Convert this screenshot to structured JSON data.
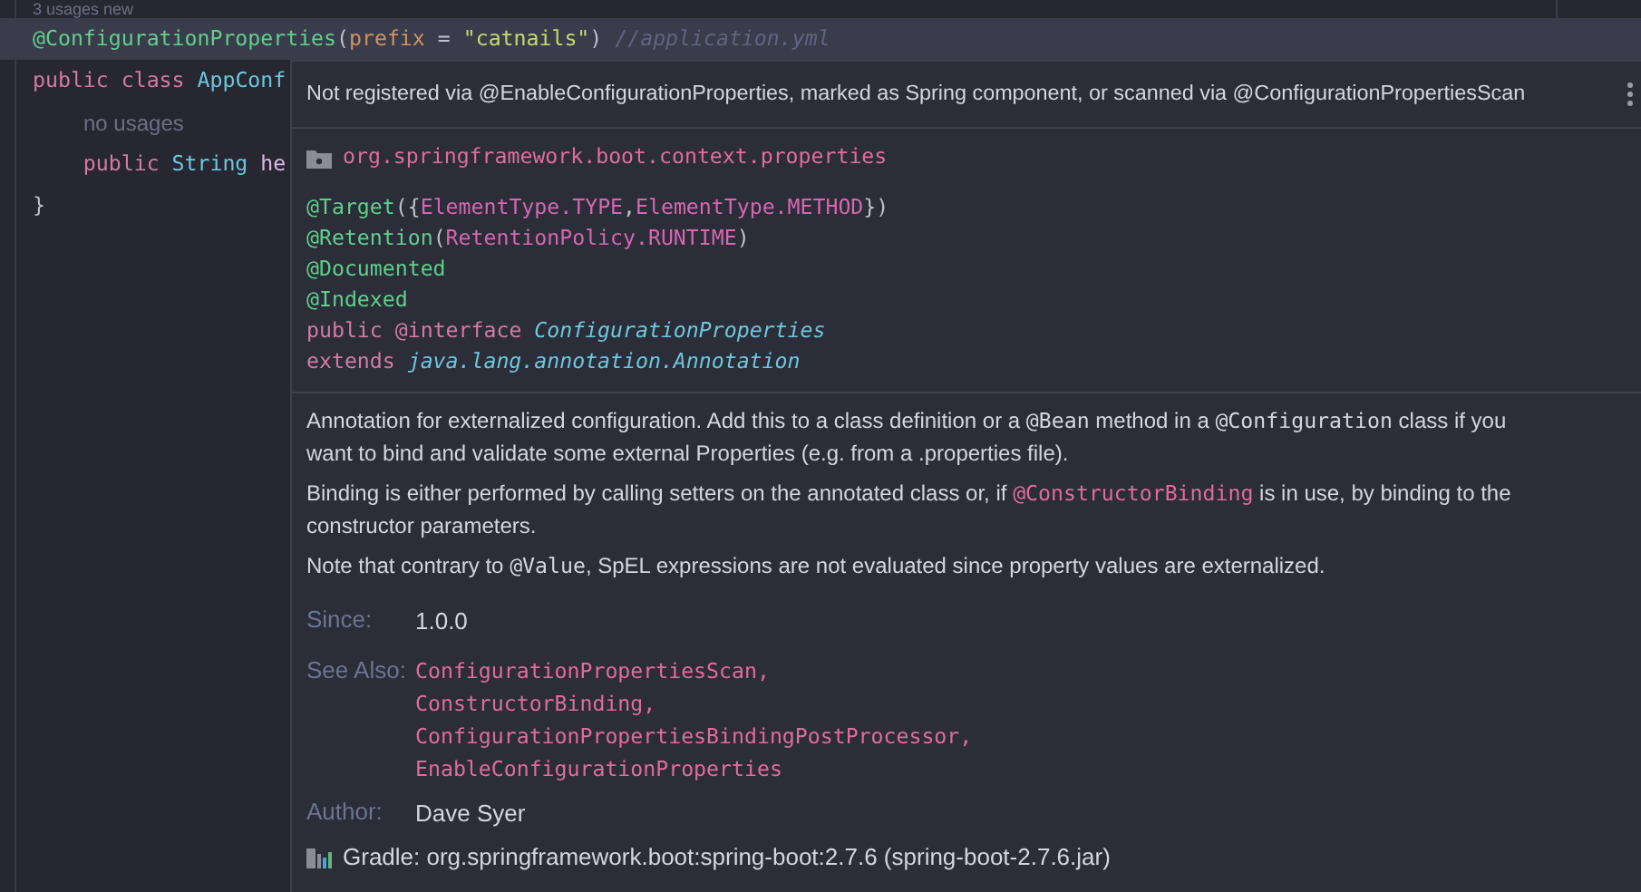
{
  "editor": {
    "inlay_hint": "3 usages  new",
    "lines": [
      {
        "current": true,
        "segments": [
          {
            "text": "@ConfigurationProperties",
            "kind": "annotation"
          },
          {
            "text": "(",
            "kind": "plain"
          },
          {
            "text": "prefix",
            "kind": "param"
          },
          {
            "text": " = ",
            "kind": "plain"
          },
          {
            "text": "\"catnails\"",
            "kind": "string"
          },
          {
            "text": ")",
            "kind": "plain"
          },
          {
            "text": " //application.yml",
            "kind": "comment"
          }
        ]
      },
      {
        "current": false,
        "segments": [
          {
            "text": "public class ",
            "kind": "keyword"
          },
          {
            "text": "AppConf",
            "kind": "type"
          }
        ]
      },
      {
        "current": false,
        "hint": "no usages"
      },
      {
        "current": false,
        "segments": [
          {
            "text": "    public ",
            "kind": "keyword"
          },
          {
            "text": "String ",
            "kind": "type"
          },
          {
            "text": "he",
            "kind": "field"
          }
        ]
      },
      {
        "current": false,
        "segments": [
          {
            "text": "}",
            "kind": "plain"
          }
        ]
      }
    ]
  },
  "popup": {
    "warning": "Not registered via @EnableConfigurationProperties, marked as Spring component, or scanned via @ConfigurationPropertiesScan",
    "package": "org.springframework.boot.context.properties",
    "signature": [
      [
        {
          "text": "@Target",
          "kind": "annotation"
        },
        {
          "text": "({",
          "kind": "plain"
        },
        {
          "text": "ElementType.TYPE",
          "kind": "enum"
        },
        {
          "text": ",",
          "kind": "plain"
        },
        {
          "text": "ElementType.METHOD",
          "kind": "enum"
        },
        {
          "text": "})",
          "kind": "plain"
        }
      ],
      [
        {
          "text": "@Retention",
          "kind": "annotation"
        },
        {
          "text": "(",
          "kind": "plain"
        },
        {
          "text": "RetentionPolicy.RUNTIME",
          "kind": "enum"
        },
        {
          "text": ")",
          "kind": "plain"
        }
      ],
      [
        {
          "text": "@Documented",
          "kind": "annotation"
        }
      ],
      [
        {
          "text": "@Indexed",
          "kind": "annotation"
        }
      ],
      [
        {
          "text": "public ",
          "kind": "keyword"
        },
        {
          "text": "@interface ",
          "kind": "keyword"
        },
        {
          "text": "ConfigurationProperties",
          "kind": "itype"
        }
      ],
      [
        {
          "text": "extends ",
          "kind": "keyword"
        },
        {
          "text": "java.lang.annotation.Annotation",
          "kind": "itype"
        }
      ]
    ],
    "description": [
      [
        {
          "text": "Annotation for externalized configuration. Add this to a class definition or a ",
          "kind": "text"
        },
        {
          "text": "@Bean",
          "kind": "code"
        },
        {
          "text": " method in a ",
          "kind": "text"
        },
        {
          "text": "@Configuration",
          "kind": "code"
        },
        {
          "text": " class if you want to bind and validate some external Properties (e.g. from a .properties file).",
          "kind": "text"
        }
      ],
      [
        {
          "text": "Binding is either performed by calling setters on the annotated class or, if ",
          "kind": "text"
        },
        {
          "text": "@ConstructorBinding",
          "kind": "link"
        },
        {
          "text": " is in use, by binding to the constructor parameters.",
          "kind": "text"
        }
      ],
      [
        {
          "text": "Note that contrary to ",
          "kind": "text"
        },
        {
          "text": "@Value",
          "kind": "code"
        },
        {
          "text": ", SpEL expressions are not evaluated since property values are externalized.",
          "kind": "text"
        }
      ]
    ],
    "since_label": "Since:",
    "since": "1.0.0",
    "see_also_label": "See Also:",
    "see_also": [
      "ConfigurationPropertiesScan,",
      "ConstructorBinding,",
      "ConfigurationPropertiesBindingPostProcessor,",
      "EnableConfigurationProperties"
    ],
    "author_label": "Author:",
    "author": "Dave Syer",
    "source": "Gradle: org.springframework.boot:spring-boot:2.7.6 (spring-boot-2.7.6.jar)"
  }
}
